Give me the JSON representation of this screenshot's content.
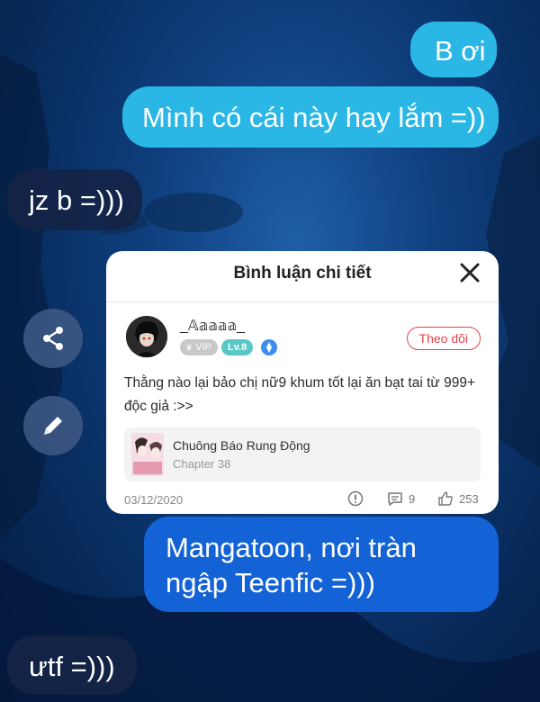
{
  "chat": {
    "messages": [
      {
        "side": "right",
        "text": "B ơi"
      },
      {
        "side": "right",
        "text": "Mình có cái này hay lắm =))"
      },
      {
        "side": "left",
        "text": "jz b =)))"
      },
      {
        "side": "right",
        "text": "Mangatoon, nơi tràn ngập Teenfic =)))"
      },
      {
        "side": "left",
        "text": "ưtf =)))"
      }
    ]
  },
  "side_actions": {
    "share_icon": "share-icon",
    "edit_icon": "pencil-icon"
  },
  "card": {
    "title": "Bình luận chi tiết",
    "close_icon": "close-icon",
    "user": {
      "name": "_𝔸𝕒𝕒𝕒𝕒_",
      "vip": "VIP",
      "level": "Lv.8"
    },
    "follow_label": "Theo dõi",
    "comment": "Thằng nào lại bảo chị nữ9 khum tốt lại ăn bạt tai từ 999+ độc giả :>>",
    "manga": {
      "title": "Chuông Báo Rung Động",
      "chapter": "Chapter 38"
    },
    "date": "03/12/2020",
    "replies": "9",
    "likes": "253"
  },
  "colors": {
    "bubble_cyan": "#2ab7e6",
    "bubble_blue": "#1463d6",
    "bubble_dark": "#142446",
    "follow_red": "#e2434b",
    "level_teal": "#59c7c4"
  }
}
